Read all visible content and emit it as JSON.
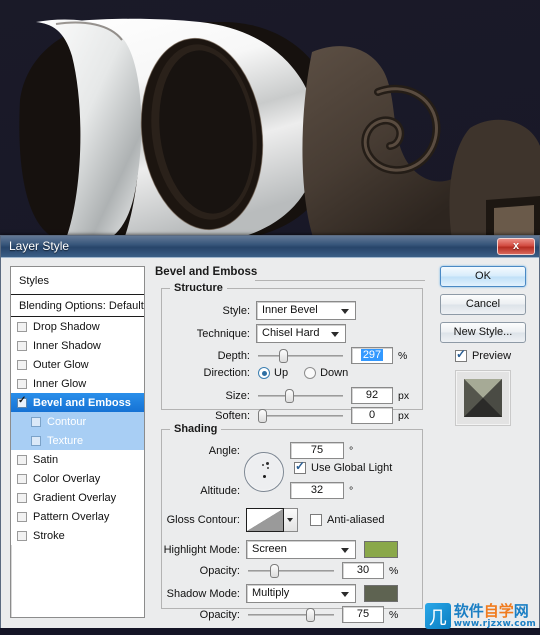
{
  "window": {
    "title": "Layer Style",
    "close_label": "x",
    "close_icon": "close-icon"
  },
  "styles_panel": {
    "header": "Styles",
    "blending_options": "Blending Options: Default",
    "items": [
      {
        "label": "Drop Shadow",
        "checked": false,
        "sub": false,
        "selected": false
      },
      {
        "label": "Inner Shadow",
        "checked": false,
        "sub": false,
        "selected": false
      },
      {
        "label": "Outer Glow",
        "checked": false,
        "sub": false,
        "selected": false
      },
      {
        "label": "Inner Glow",
        "checked": false,
        "sub": false,
        "selected": false
      },
      {
        "label": "Bevel and Emboss",
        "checked": true,
        "sub": false,
        "selected": true
      },
      {
        "label": "Contour",
        "checked": false,
        "sub": true,
        "selected": false
      },
      {
        "label": "Texture",
        "checked": false,
        "sub": true,
        "selected": false
      },
      {
        "label": "Satin",
        "checked": false,
        "sub": false,
        "selected": false
      },
      {
        "label": "Color Overlay",
        "checked": false,
        "sub": false,
        "selected": false
      },
      {
        "label": "Gradient Overlay",
        "checked": false,
        "sub": false,
        "selected": false
      },
      {
        "label": "Pattern Overlay",
        "checked": false,
        "sub": false,
        "selected": false
      },
      {
        "label": "Stroke",
        "checked": false,
        "sub": false,
        "selected": false
      }
    ]
  },
  "main": {
    "section_title": "Bevel and Emboss",
    "structure": {
      "title": "Structure",
      "style_label": "Style:",
      "style_value": "Inner Bevel",
      "technique_label": "Technique:",
      "technique_value": "Chisel Hard",
      "depth_label": "Depth:",
      "depth_value": "297",
      "depth_unit": "%",
      "depth_slider_pct": 27,
      "direction_label": "Direction:",
      "direction_up": "Up",
      "direction_down": "Down",
      "direction_selected": "Up",
      "size_label": "Size:",
      "size_value": "92",
      "size_unit": "px",
      "size_slider_pct": 34,
      "soften_label": "Soften:",
      "soften_value": "0",
      "soften_unit": "px",
      "soften_slider_pct": 0
    },
    "shading": {
      "title": "Shading",
      "angle_label": "Angle:",
      "angle_value": "75",
      "angle_unit": "°",
      "use_global_light_label": "Use Global Light",
      "use_global_light_checked": true,
      "altitude_label": "Altitude:",
      "altitude_value": "32",
      "altitude_unit": "°",
      "gloss_contour_label": "Gloss Contour:",
      "anti_aliased_label": "Anti-aliased",
      "anti_aliased_checked": false,
      "highlight_mode_label": "Highlight Mode:",
      "highlight_mode_value": "Screen",
      "highlight_color": "#8aa84a",
      "highlight_opacity_label": "Opacity:",
      "highlight_opacity_value": "30",
      "highlight_opacity_unit": "%",
      "highlight_opacity_pct": 30,
      "shadow_mode_label": "Shadow Mode:",
      "shadow_mode_value": "Multiply",
      "shadow_color": "#5e6351",
      "shadow_opacity_label": "Opacity:",
      "shadow_opacity_value": "75",
      "shadow_opacity_unit": "%",
      "shadow_opacity_pct": 72
    }
  },
  "buttons": {
    "ok": "OK",
    "cancel": "Cancel",
    "new_style": "New Style...",
    "preview_label": "Preview",
    "preview_checked": true
  },
  "watermark": {
    "cn_blue_1": "软件",
    "cn_orange": "自学",
    "cn_blue_2": "网",
    "url": "www.rjzxw.com"
  },
  "artwork": {
    "background_color": "#191929",
    "letter": "D",
    "letter_color": "#fdfdfd",
    "ornament_color": "#4b4038"
  }
}
